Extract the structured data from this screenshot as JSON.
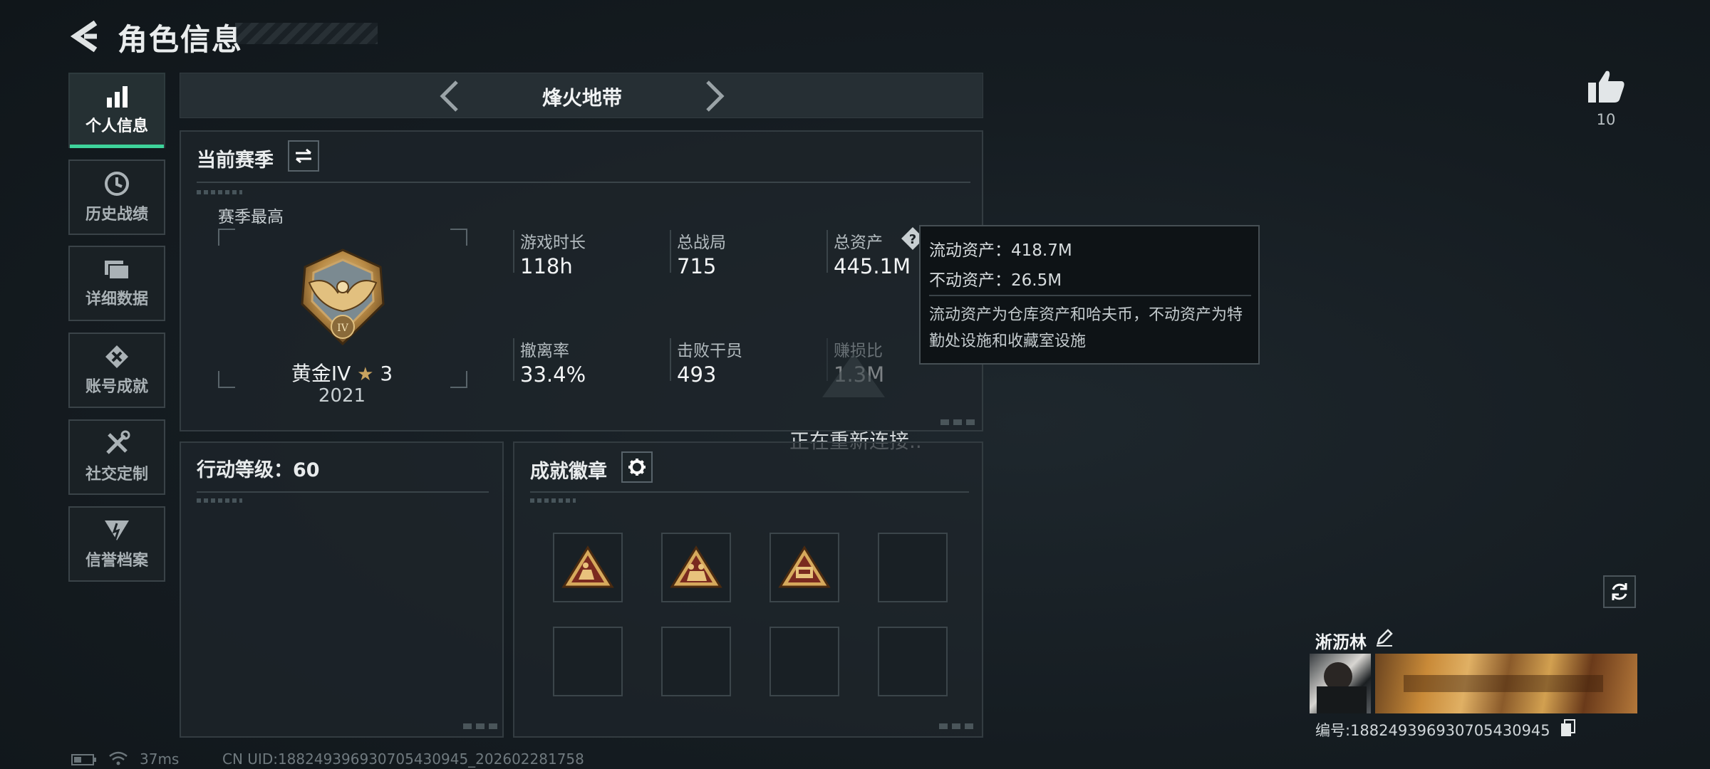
{
  "header": {
    "title": "角色信息"
  },
  "sidebar": {
    "items": [
      {
        "label": "个人信息",
        "icon": "bar-chart-icon",
        "active": true
      },
      {
        "label": "历史战绩",
        "icon": "history-clock-icon",
        "active": false
      },
      {
        "label": "详细数据",
        "icon": "folder-icon",
        "active": false
      },
      {
        "label": "账号成就",
        "icon": "achievement-diamond-icon",
        "active": false
      },
      {
        "label": "社交定制",
        "icon": "wrench-tools-icon",
        "active": false
      },
      {
        "label": "信誉档案",
        "icon": "shield-emblem-icon",
        "active": false
      }
    ]
  },
  "mode": {
    "name": "烽火地带"
  },
  "season": {
    "title": "当前赛季",
    "best_label": "赛季最高",
    "rank": "黄金IV",
    "stars": "3",
    "rank_score": "2021",
    "rank_numeral": "IV",
    "stats": [
      {
        "label": "游戏时长",
        "value": "118h"
      },
      {
        "label": "总战局",
        "value": "715"
      },
      {
        "label": "总资产",
        "value": "445.1M"
      },
      {
        "label": "撤离率",
        "value": "33.4%"
      },
      {
        "label": "击败干员",
        "value": "493"
      },
      {
        "label": "赚损比",
        "value": "1.3M"
      }
    ]
  },
  "tooltip": {
    "liquid": "流动资产：418.7M",
    "fixed": "不动资产：26.5M",
    "desc": "流动资产为仓库资产和哈夫币，不动资产为特勤处设施和收藏室设施"
  },
  "reconnect": "正在重新连接..",
  "action_level": {
    "title": "行动等级：60"
  },
  "achievements": {
    "title": "成就徽章",
    "badges": [
      {
        "icon": "rescue-badge-icon",
        "filled": true
      },
      {
        "icon": "squad-badge-icon",
        "filled": true
      },
      {
        "icon": "vehicle-badge-icon",
        "filled": true
      },
      {
        "filled": false
      },
      {
        "filled": false
      },
      {
        "filled": false
      },
      {
        "filled": false
      },
      {
        "filled": false
      }
    ]
  },
  "likes": {
    "count": "10"
  },
  "player": {
    "name": "淅沥林",
    "id_line": "编号:1882493969307054309​45"
  },
  "status": {
    "ping": "37ms",
    "uid": "CN UID:188249396930705430945_202602281758"
  },
  "colors": {
    "accent": "#3ed39b",
    "gold": "#c9a35f",
    "badge_red": "#7a2a1f"
  }
}
